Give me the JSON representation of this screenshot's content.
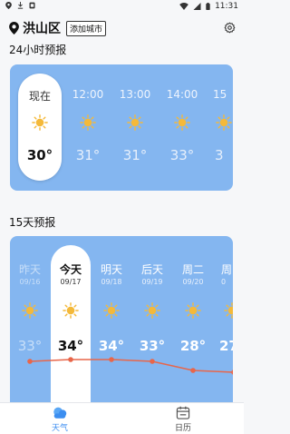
{
  "status_bar": {
    "time": "11:31",
    "left_icons": [
      "location-icon",
      "download-icon",
      "notification-icon"
    ],
    "right_icons": [
      "wifi-icon",
      "signal-icon",
      "battery-icon"
    ]
  },
  "header": {
    "city": "洪山区",
    "add_city_label": "添加城市"
  },
  "hourly": {
    "title": "24小时预报",
    "items": [
      {
        "time": "现在",
        "temp": "30°",
        "icon": "sun-icon"
      },
      {
        "time": "12:00",
        "temp": "31°",
        "icon": "sun-icon"
      },
      {
        "time": "13:00",
        "temp": "31°",
        "icon": "sun-icon"
      },
      {
        "time": "14:00",
        "temp": "33°",
        "icon": "sun-icon"
      },
      {
        "time": "15",
        "temp": "3",
        "icon": "sun-icon"
      }
    ]
  },
  "daily": {
    "title": "15天预报",
    "items": [
      {
        "day": "昨天",
        "date": "09/16",
        "temp": "33°",
        "icon": "sun-icon"
      },
      {
        "day": "今天",
        "date": "09/17",
        "temp": "34°",
        "icon": "sun-icon"
      },
      {
        "day": "明天",
        "date": "09/18",
        "temp": "34°",
        "icon": "sun-icon"
      },
      {
        "day": "后天",
        "date": "09/19",
        "temp": "33°",
        "icon": "sun-icon"
      },
      {
        "day": "周二",
        "date": "09/20",
        "temp": "28°",
        "icon": "sun-icon"
      },
      {
        "day": "周",
        "date": "0",
        "temp": "27",
        "icon": "sun-icon"
      }
    ],
    "trend_values": [
      33,
      34,
      34,
      33,
      28,
      27
    ]
  },
  "bottom_nav": {
    "items": [
      {
        "label": "天气",
        "icon": "cloud-icon",
        "active": true
      },
      {
        "label": "日历",
        "icon": "calendar-icon",
        "active": false
      }
    ]
  },
  "colors": {
    "card_blue": "#84b6f0",
    "accent": "#3c8ef0",
    "trend_line": "#e8664a",
    "sun": "#f4b93a"
  }
}
